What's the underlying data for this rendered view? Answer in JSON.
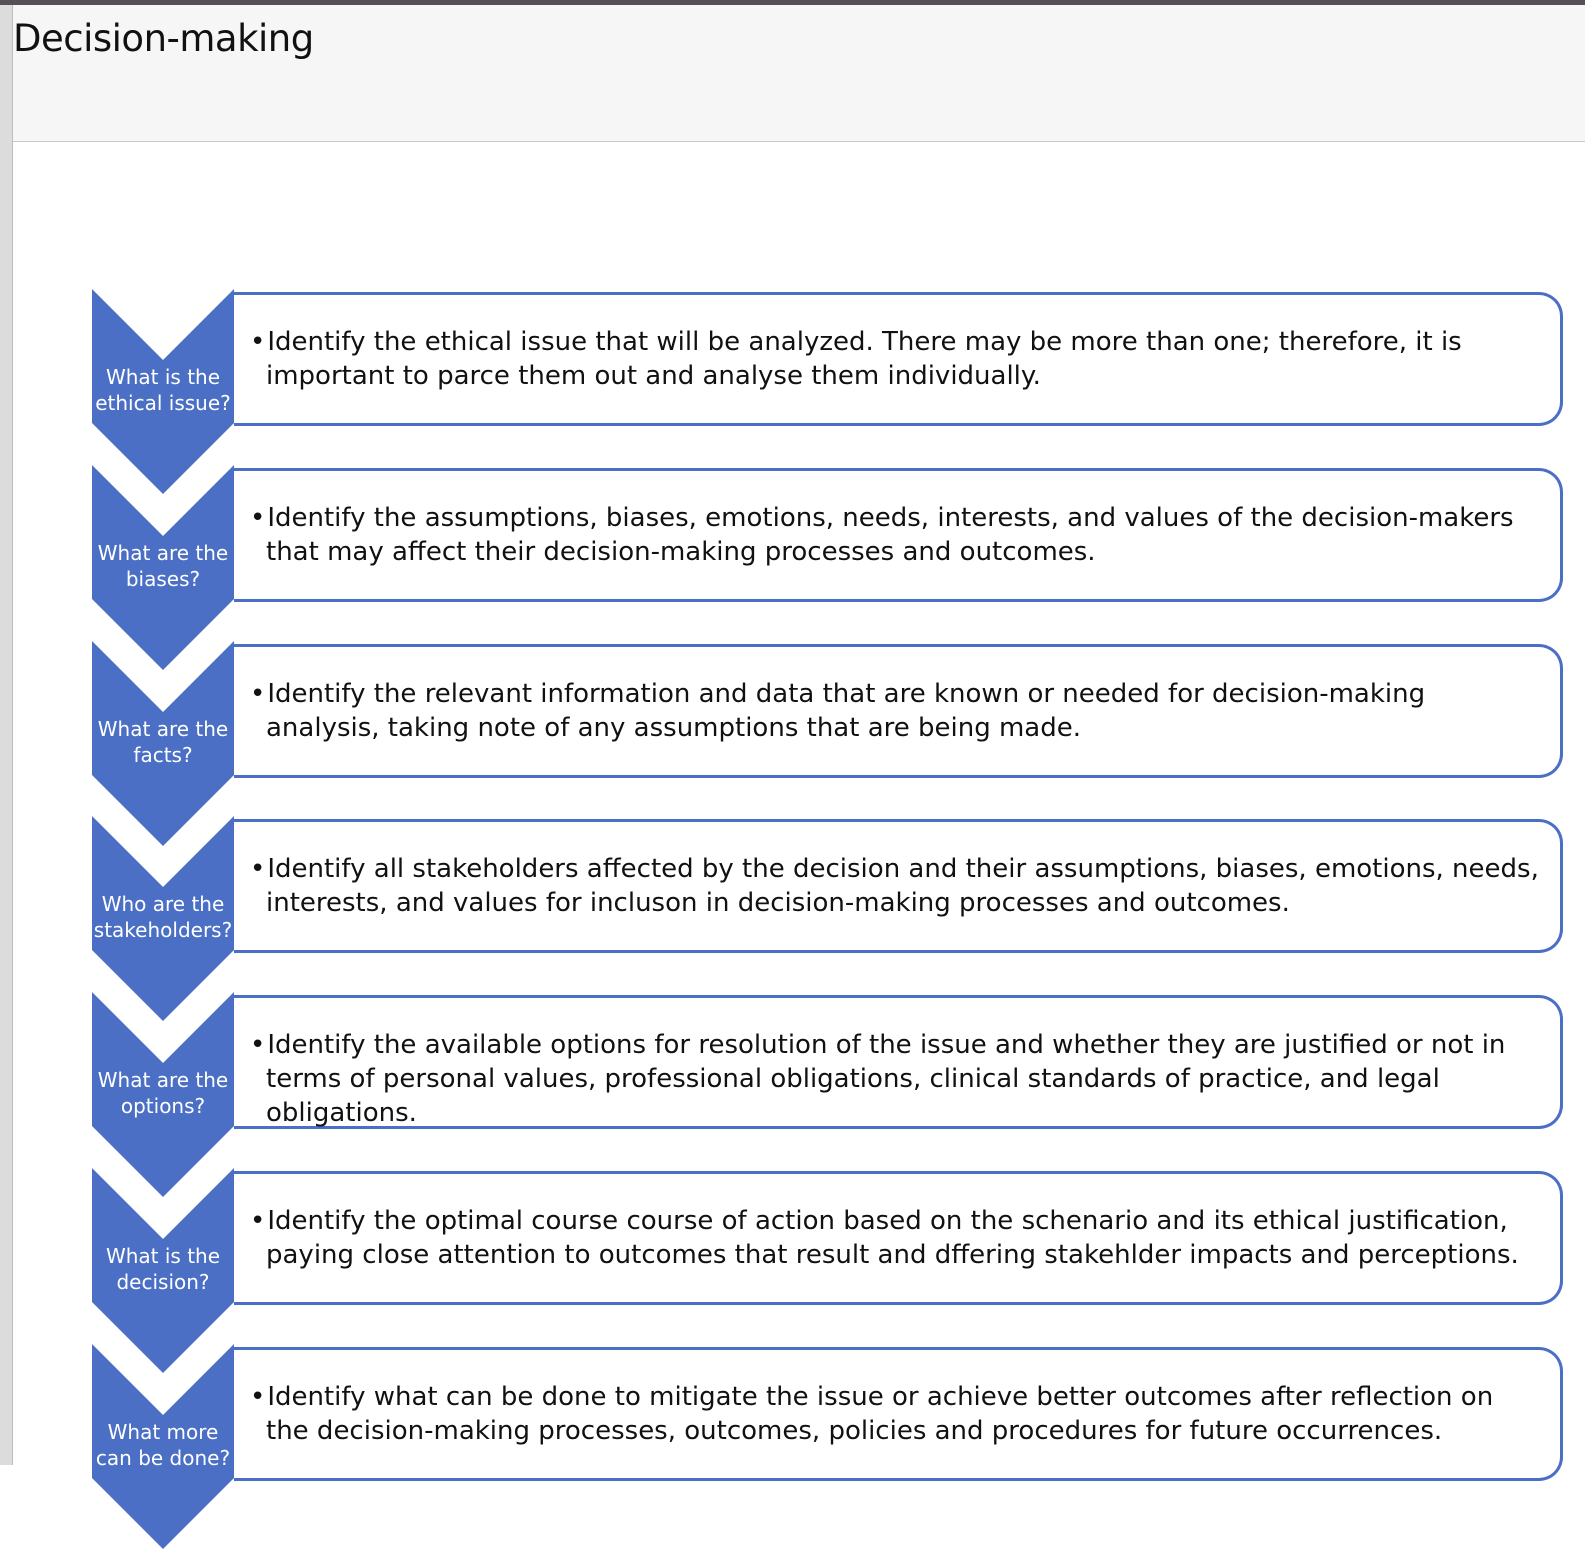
{
  "page": {
    "title": "Decision-making"
  },
  "diagram": {
    "colors": {
      "chevron_fill": "#4a6fc4",
      "box_border": "#4a6fc4",
      "label_text": "#ffffff"
    },
    "bullet": "•",
    "steps": [
      {
        "label_line1": "What is the",
        "label_line2": "ethical issue?",
        "text": "Identify the ethical issue that will be analyzed.  There may be more than one; therefore, it is important to parce them out and analyse them individually."
      },
      {
        "label_line1": "What are the",
        "label_line2": "biases?",
        "text": "Identify the assumptions, biases, emotions, needs, interests, and values of the decision-makers that may affect their decision-making processes and outcomes."
      },
      {
        "label_line1": "What are the",
        "label_line2": "facts?",
        "text": "Identify the relevant information and data that are known or needed for decision-making analysis, taking note of any assumptions that are being made."
      },
      {
        "label_line1": "Who are the",
        "label_line2": "stakeholders?",
        "text": "Identify all stakeholders affected by the decision and their assumptions, biases, emotions, needs, interests, and values for incluson in decision-making processes and outcomes."
      },
      {
        "label_line1": "What are the",
        "label_line2": "options?",
        "text": "Identify the available options for resolution of the issue and whether they are justified or not in terms of personal values, professional obligations, clinical standards of practice, and legal obligations."
      },
      {
        "label_line1": "What is the",
        "label_line2": "decision?",
        "text": "Identify the optimal course course of action based on the schenario and its ethical justification, paying close attention to outcomes that result and dffering stakehlder impacts and perceptions."
      },
      {
        "label_line1": "What more",
        "label_line2": "can be done?",
        "text": "Identify what can be done to mitigate the issue or achieve better outcomes after reflection on the decision-making processes, outcomes, policies and procedures for future occurrences."
      }
    ]
  }
}
